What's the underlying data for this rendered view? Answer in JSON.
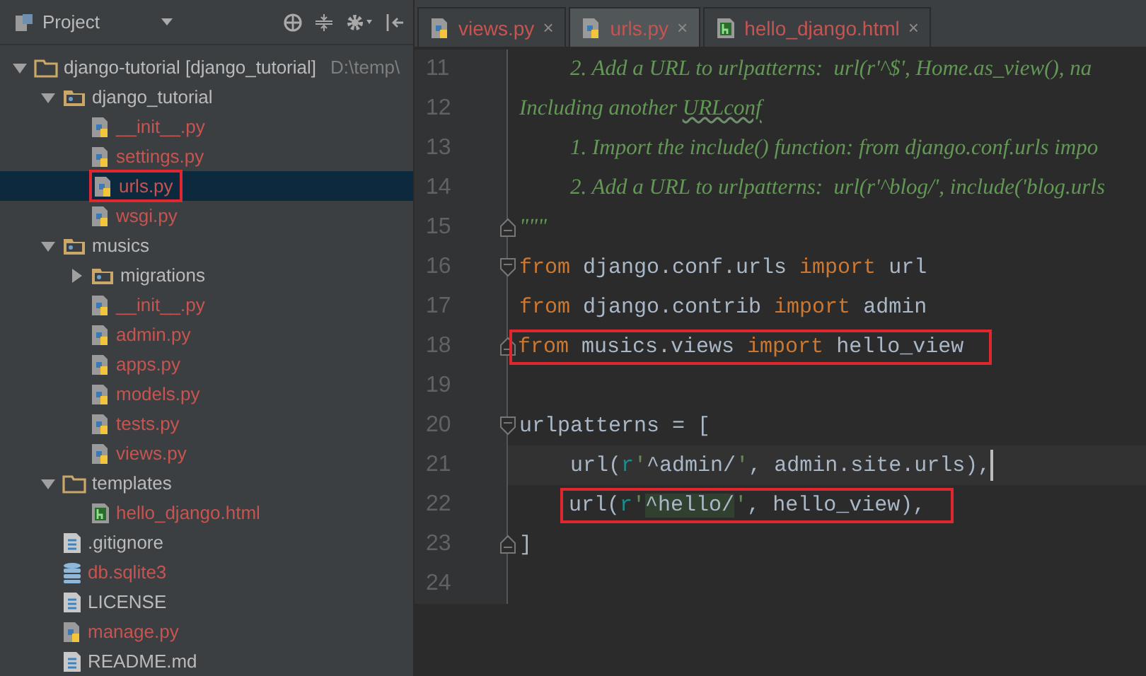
{
  "project_panel": {
    "title": "Project",
    "tree": [
      {
        "name": "django-tutorial [django_tutorial]",
        "path": "D:\\temp\\",
        "kind": "folder",
        "expanded": true,
        "selected": false,
        "annotated": false,
        "color": "#bbbbbb",
        "children": [
          {
            "name": "django_tutorial",
            "kind": "module",
            "expanded": true,
            "selected": false,
            "annotated": false,
            "color": "#bbbbbb",
            "children": [
              {
                "name": "__init__.py",
                "kind": "python",
                "selected": false,
                "annotated": false,
                "color": "#c75450"
              },
              {
                "name": "settings.py",
                "kind": "python",
                "selected": false,
                "annotated": false,
                "color": "#c75450"
              },
              {
                "name": "urls.py",
                "kind": "python",
                "selected": true,
                "annotated": true,
                "color": "#c75450"
              },
              {
                "name": "wsgi.py",
                "kind": "python",
                "selected": false,
                "annotated": false,
                "color": "#c75450"
              }
            ]
          },
          {
            "name": "musics",
            "kind": "module",
            "expanded": true,
            "selected": false,
            "annotated": false,
            "color": "#bbbbbb",
            "children": [
              {
                "name": "migrations",
                "kind": "module",
                "expanded": false,
                "selected": false,
                "annotated": false,
                "color": "#bbbbbb"
              },
              {
                "name": "__init__.py",
                "kind": "python",
                "selected": false,
                "annotated": false,
                "color": "#c75450"
              },
              {
                "name": "admin.py",
                "kind": "python",
                "selected": false,
                "annotated": false,
                "color": "#c75450"
              },
              {
                "name": "apps.py",
                "kind": "python",
                "selected": false,
                "annotated": false,
                "color": "#c75450"
              },
              {
                "name": "models.py",
                "kind": "python",
                "selected": false,
                "annotated": false,
                "color": "#c75450"
              },
              {
                "name": "tests.py",
                "kind": "python",
                "selected": false,
                "annotated": false,
                "color": "#c75450"
              },
              {
                "name": "views.py",
                "kind": "python",
                "selected": false,
                "annotated": false,
                "color": "#c75450"
              }
            ]
          },
          {
            "name": "templates",
            "kind": "folder",
            "expanded": true,
            "selected": false,
            "annotated": false,
            "color": "#bbbbbb",
            "children": [
              {
                "name": "hello_django.html",
                "kind": "html",
                "selected": false,
                "annotated": false,
                "color": "#c75450"
              }
            ]
          },
          {
            "name": ".gitignore",
            "kind": "text",
            "selected": false,
            "annotated": false,
            "color": "#bbbbbb"
          },
          {
            "name": "db.sqlite3",
            "kind": "database",
            "selected": false,
            "annotated": false,
            "color": "#c75450"
          },
          {
            "name": "LICENSE",
            "kind": "text",
            "selected": false,
            "annotated": false,
            "color": "#bbbbbb"
          },
          {
            "name": "manage.py",
            "kind": "python",
            "selected": false,
            "annotated": false,
            "color": "#c75450"
          },
          {
            "name": "README.md",
            "kind": "text",
            "selected": false,
            "annotated": false,
            "color": "#bbbbbb"
          }
        ]
      }
    ]
  },
  "tabs": [
    {
      "label": "views.py",
      "kind": "python",
      "selected": false,
      "close": "×"
    },
    {
      "label": "urls.py",
      "kind": "python",
      "selected": true,
      "close": "×"
    },
    {
      "label": "hello_django.html",
      "kind": "html",
      "selected": false,
      "close": "×"
    }
  ],
  "editor": {
    "lines": [
      {
        "number": "11",
        "indented": true,
        "caret": false,
        "tokens": [
          {
            "kind": "doc",
            "text": "2. Add a URL to urlpatterns:  url(r'^$', Home.as_view(), na"
          }
        ]
      },
      {
        "number": "12",
        "indented": false,
        "caret": false,
        "tokens": [
          {
            "kind": "doc",
            "text": "Including another "
          },
          {
            "kind": "typo",
            "text": "URLconf"
          }
        ]
      },
      {
        "number": "13",
        "indented": true,
        "caret": false,
        "tokens": [
          {
            "kind": "doc",
            "text": "1. Import the include() function: from django.conf.urls impo"
          }
        ]
      },
      {
        "number": "14",
        "indented": true,
        "caret": false,
        "tokens": [
          {
            "kind": "doc",
            "text": "2. Add a URL to urlpatterns:  url(r'^blog/', include('blog.urls"
          }
        ]
      },
      {
        "number": "15",
        "fold_marker": {
          "kind": "end"
        },
        "indented": false,
        "caret": false,
        "tokens": [
          {
            "kind": "doc",
            "text": "\"\"\""
          }
        ]
      },
      {
        "number": "16",
        "fold_marker": {
          "kind": "start"
        },
        "indented": false,
        "caret": false,
        "tokens": [
          {
            "kind": "kw",
            "text": "from"
          },
          {
            "kind": "plain",
            "text": " django.conf.urls "
          },
          {
            "kind": "kw",
            "text": "import"
          },
          {
            "kind": "plain",
            "text": " url"
          }
        ]
      },
      {
        "number": "17",
        "indented": false,
        "caret": false,
        "tokens": [
          {
            "kind": "kw",
            "text": "from"
          },
          {
            "kind": "plain",
            "text": " django.contrib "
          },
          {
            "kind": "kw",
            "text": "import"
          },
          {
            "kind": "plain",
            "text": " admin"
          }
        ]
      },
      {
        "number": "18",
        "fold_marker": {
          "kind": "end"
        },
        "indented": false,
        "annotated": true,
        "caret": false,
        "tokens": [
          {
            "kind": "kw",
            "text": "from"
          },
          {
            "kind": "plain",
            "text": " musics.views "
          },
          {
            "kind": "kw",
            "text": "import"
          },
          {
            "kind": "plain",
            "text": " hello_view"
          }
        ]
      },
      {
        "number": "19",
        "caret": false
      },
      {
        "number": "20",
        "fold_marker": {
          "kind": "start"
        },
        "indented": false,
        "caret": false,
        "tokens": [
          {
            "kind": "plain",
            "text": "urlpatterns = ["
          }
        ]
      },
      {
        "number": "21",
        "indented": true,
        "caret": true,
        "tokens": [
          {
            "kind": "plain",
            "text": "url("
          },
          {
            "kind": "prefix",
            "text": "r"
          },
          {
            "kind": "quote",
            "text": "'"
          },
          {
            "kind": "regex",
            "text": "^admin/"
          },
          {
            "kind": "quote",
            "text": "'"
          },
          {
            "kind": "plain",
            "text": ", admin.site.urls),"
          }
        ]
      },
      {
        "number": "22",
        "indented": true,
        "annotated": true,
        "caret": false,
        "tokens": [
          {
            "kind": "plain",
            "text": "url("
          },
          {
            "kind": "prefix",
            "text": "r"
          },
          {
            "kind": "quote",
            "text": "'"
          },
          {
            "kind": "match",
            "text": "^hello/"
          },
          {
            "kind": "quote",
            "text": "'"
          },
          {
            "kind": "plain",
            "text": ", hello_view),"
          }
        ]
      },
      {
        "number": "23",
        "fold_marker": {
          "kind": "end"
        },
        "indented": false,
        "caret": false,
        "tokens": [
          {
            "kind": "plain",
            "text": "]"
          }
        ]
      },
      {
        "number": "24",
        "caret": false
      }
    ]
  }
}
